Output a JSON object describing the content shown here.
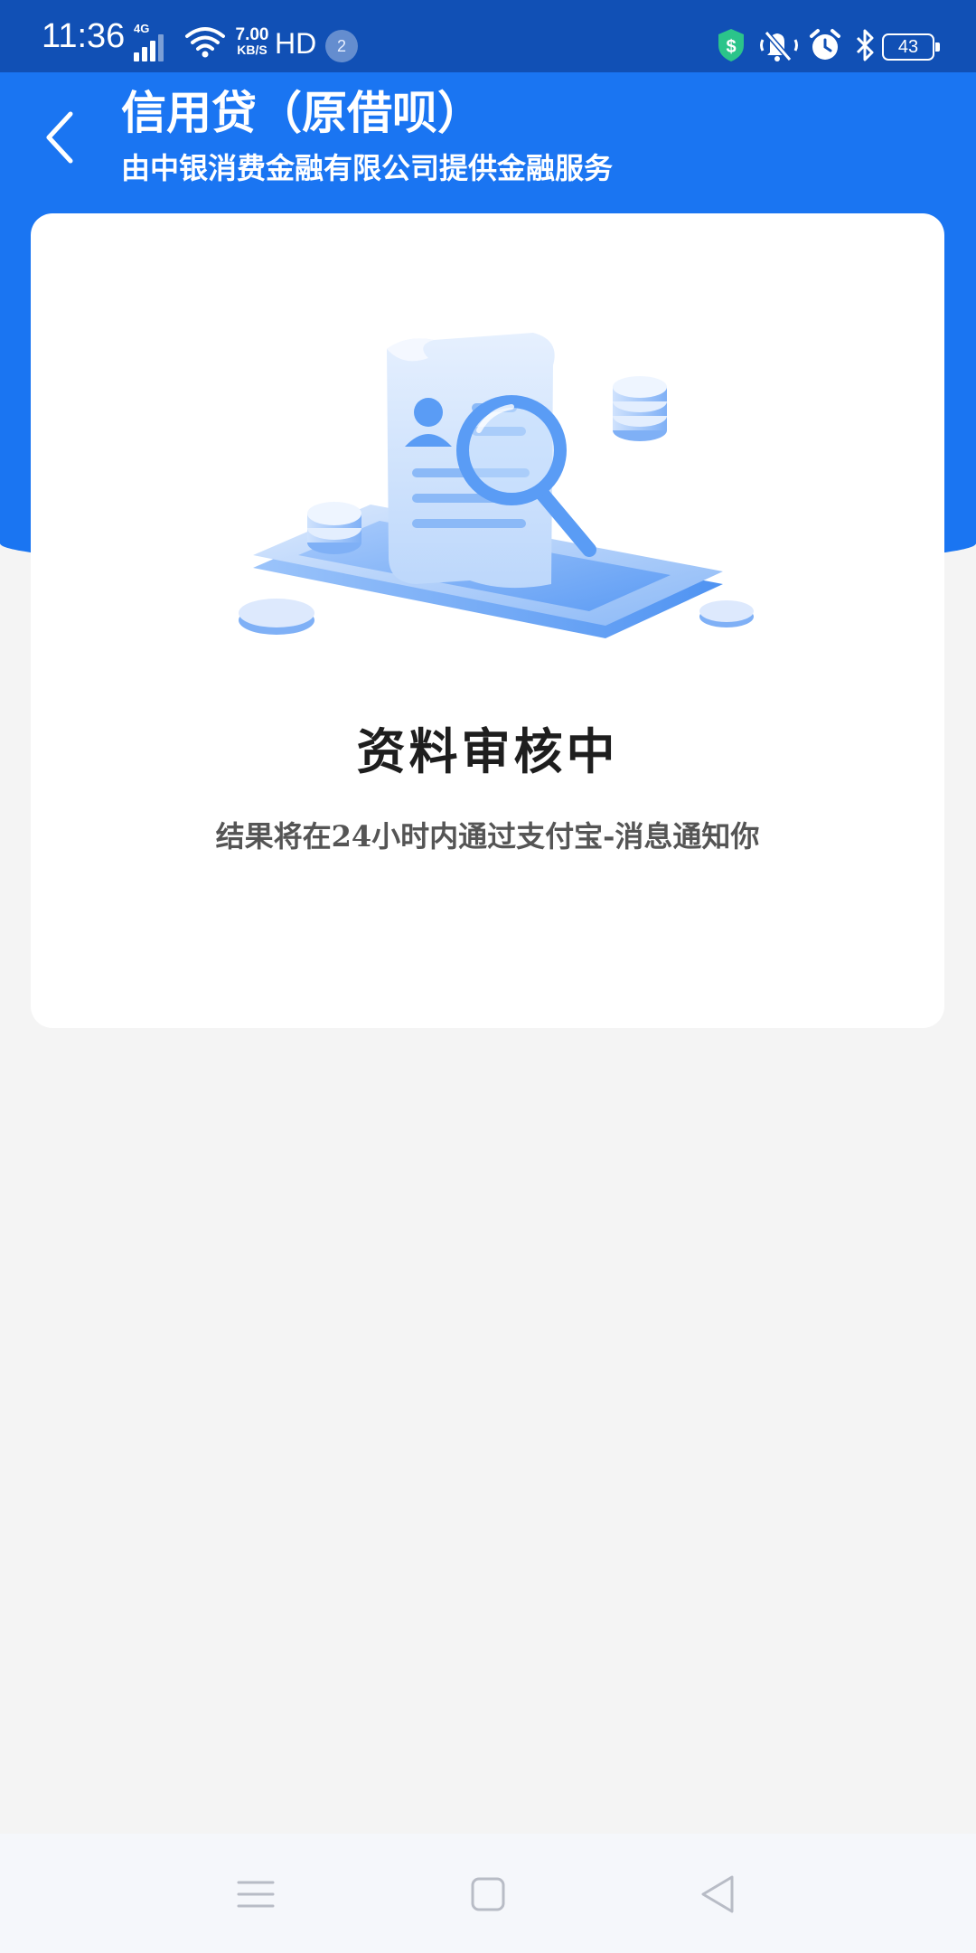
{
  "status_bar": {
    "time": "11:36",
    "network_type": "4G",
    "net_speed_value": "7.00",
    "net_speed_unit": "KB/S",
    "hd_label": "HD",
    "notification_count": "2",
    "battery_level": "43",
    "icons": [
      "signal-icon",
      "wifi-icon",
      "shield-dollar-icon",
      "mute-icon",
      "alarm-icon",
      "bluetooth-icon",
      "battery-icon"
    ]
  },
  "header": {
    "title": "信用贷（原借呗）",
    "subtitle": "由中银消费金融有限公司提供金融服务",
    "back_icon": "chevron-left-icon"
  },
  "card": {
    "illustration_icon": "document-review-illustration",
    "status_title": "资料审核中",
    "status_description": "结果将在24小时内通过支付宝-消息通知你"
  },
  "nav_bar": {
    "buttons": [
      "menu-icon",
      "home-icon",
      "back-triangle-icon"
    ]
  },
  "colors": {
    "status_bar": "#1150b5",
    "header": "#1a75f2",
    "background": "#f4f4f4",
    "card": "#ffffff",
    "illustration_blue": "#5a9cf5"
  }
}
